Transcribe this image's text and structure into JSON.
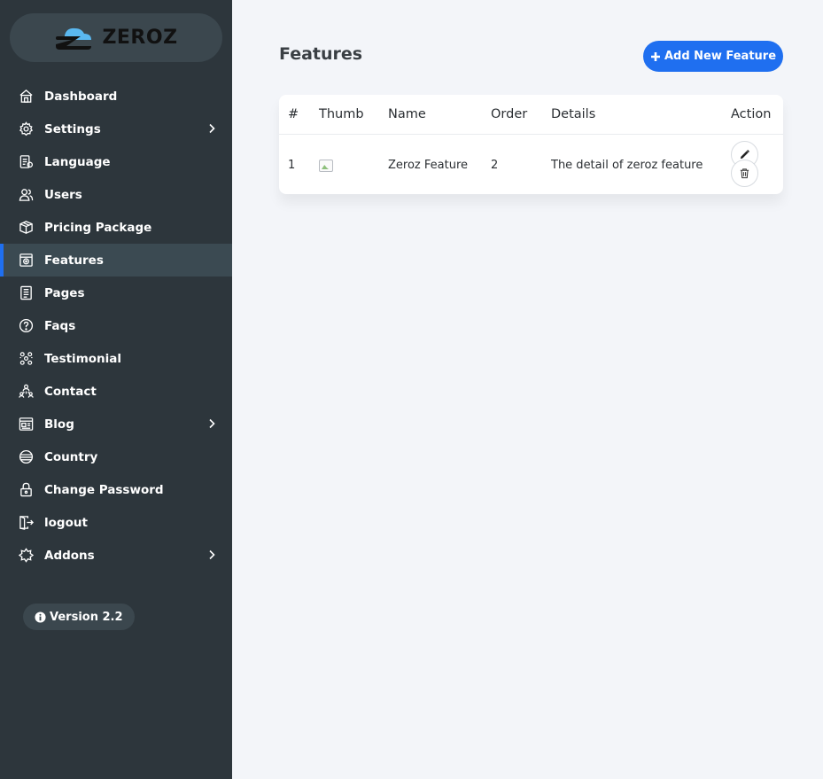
{
  "brand": {
    "name": "ZEROZ"
  },
  "sidebar": {
    "items": [
      {
        "label": "Dashboard",
        "icon": "dashboard-icon",
        "has_submenu": false,
        "active": false
      },
      {
        "label": "Settings",
        "icon": "gear-icon",
        "has_submenu": true,
        "active": false
      },
      {
        "label": "Language",
        "icon": "language-icon",
        "has_submenu": false,
        "active": false
      },
      {
        "label": "Users",
        "icon": "users-icon",
        "has_submenu": false,
        "active": false
      },
      {
        "label": "Pricing Package",
        "icon": "package-icon",
        "has_submenu": false,
        "active": false
      },
      {
        "label": "Features",
        "icon": "features-icon",
        "has_submenu": false,
        "active": true
      },
      {
        "label": "Pages",
        "icon": "pages-icon",
        "has_submenu": false,
        "active": false
      },
      {
        "label": "Faqs",
        "icon": "question-icon",
        "has_submenu": false,
        "active": false
      },
      {
        "label": "Testimonial",
        "icon": "testimonial-icon",
        "has_submenu": false,
        "active": false
      },
      {
        "label": "Contact",
        "icon": "contact-icon",
        "has_submenu": false,
        "active": false
      },
      {
        "label": "Blog",
        "icon": "blog-icon",
        "has_submenu": true,
        "active": false
      },
      {
        "label": "Country",
        "icon": "globe-icon",
        "has_submenu": false,
        "active": false
      },
      {
        "label": "Change Password",
        "icon": "lock-icon",
        "has_submenu": false,
        "active": false
      },
      {
        "label": "logout",
        "icon": "logout-icon",
        "has_submenu": false,
        "active": false
      },
      {
        "label": "Addons",
        "icon": "addons-icon",
        "has_submenu": true,
        "active": false
      }
    ],
    "version": "Version 2.2"
  },
  "main": {
    "title": "Features",
    "add_button_label": "Add New Feature",
    "add_button_icon": "plus-icon",
    "table": {
      "columns": [
        "#",
        "Thumb",
        "Name",
        "Order",
        "Details",
        "Action"
      ],
      "rows": [
        {
          "index": "1",
          "name": "Zeroz Feature",
          "order": "2",
          "details": "The detail of zeroz feature"
        }
      ]
    }
  },
  "colors": {
    "sidebar_bg": "#2d363c",
    "accent": "#1f6ff0",
    "page_bg": "#f3f5f9"
  }
}
